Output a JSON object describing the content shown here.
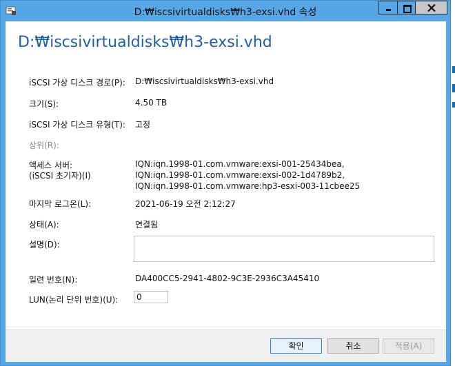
{
  "window": {
    "title": "D:₩iscsivirtualdisks₩h3-exsi.vhd 속성"
  },
  "heading": "D:₩iscsivirtualdisks₩h3-exsi.vhd",
  "fields": {
    "path_label": "iSCSI 가상 디스크 경로(P):",
    "path_value": "D:₩iscsivirtualdisks₩h3-exsi.vhd",
    "size_label": "크기(S):",
    "size_value": "4.50 TB",
    "type_label": "iSCSI 가상 디스크 유형(T):",
    "type_value": "고정",
    "parent_label": "상위(R):",
    "access_label_1": "액세스 서버:",
    "access_label_2": "(iSCSI 초기자)(I)",
    "access_servers": [
      "IQN:iqn.1998-01.com.vmware:exsi-001-25434bea,",
      "IQN:iqn.1998-01.com.vmware:exsi-002-1d4789b2,",
      "IQN:iqn.1998-01.com.vmware:hp3-esxi-003-11cbee25"
    ],
    "last_logon_label": "마지막 로그온(L):",
    "last_logon_value": "2021-06-19 오전 2:12:27",
    "status_label": "상태(A):",
    "status_value": "연결됨",
    "description_label": "설명(D):",
    "description_value": "",
    "serial_label": "일련 번호(N):",
    "serial_value": "DA400CC5-2941-4802-9C3E-2936C3A45410",
    "lun_label": "LUN(논리 단위 번호)(U):",
    "lun_value": "0"
  },
  "buttons": {
    "ok": "확인",
    "cancel": "취소",
    "apply": "적용(A)"
  },
  "colors": {
    "titlebar": "#57a7e6",
    "heading": "#1e5fa5",
    "close_button": "#c7c7c7"
  }
}
